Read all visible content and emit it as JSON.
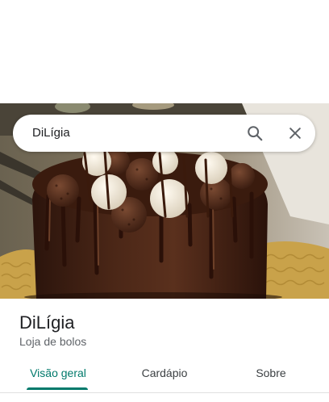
{
  "search": {
    "query": "DiLígia"
  },
  "place": {
    "name": "DiLígia",
    "category": "Loja de bolos"
  },
  "tabs": [
    {
      "label": "Visão geral",
      "active": true
    },
    {
      "label": "Cardápio",
      "active": false
    },
    {
      "label": "Sobre",
      "active": false
    }
  ],
  "colors": {
    "accent": "#00796b",
    "text_primary": "#202124",
    "text_secondary": "#5f6368"
  },
  "icons": {
    "search": "search-icon",
    "close": "close-icon"
  }
}
